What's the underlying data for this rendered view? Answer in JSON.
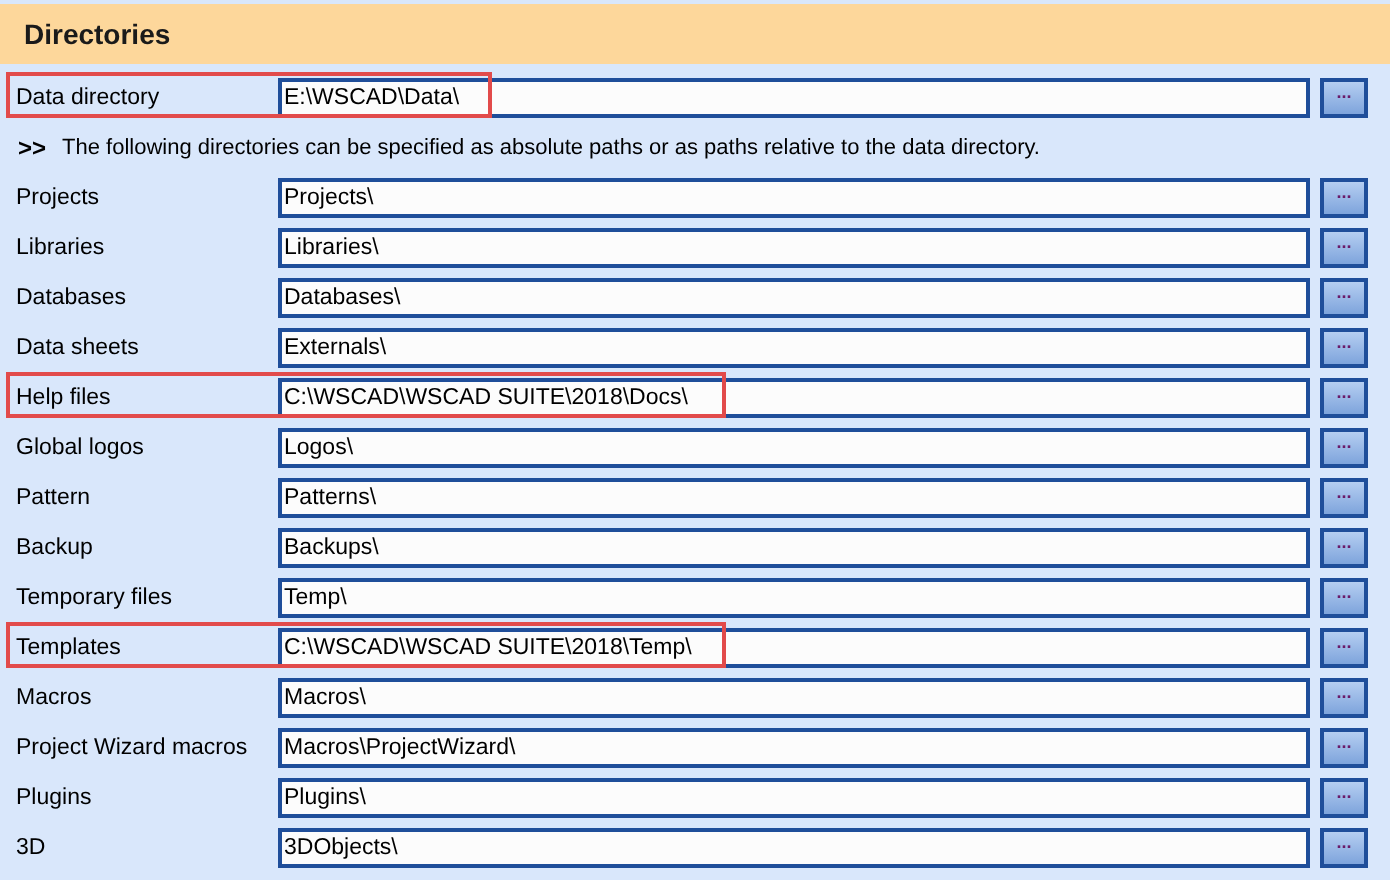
{
  "section": {
    "title": "Directories"
  },
  "rows": [
    {
      "kind": "field",
      "label": "Data directory",
      "value": "E:\\WSCAD\\Data\\",
      "button": "...",
      "highlighted": true
    },
    {
      "kind": "note",
      "marker": ">>",
      "text": "The following directories can be specified as absolute paths or as paths relative to the data directory."
    },
    {
      "kind": "field",
      "label": "Projects",
      "value": "Projects\\",
      "button": "...",
      "highlighted": false
    },
    {
      "kind": "field",
      "label": "Libraries",
      "value": "Libraries\\",
      "button": "...",
      "highlighted": false
    },
    {
      "kind": "field",
      "label": "Databases",
      "value": "Databases\\",
      "button": "...",
      "highlighted": false
    },
    {
      "kind": "field",
      "label": "Data sheets",
      "value": "Externals\\",
      "button": "...",
      "highlighted": false
    },
    {
      "kind": "field",
      "label": "Help files",
      "value": "C:\\WSCAD\\WSCAD SUITE\\2018\\Docs\\",
      "button": "...",
      "highlighted": true
    },
    {
      "kind": "field",
      "label": "Global logos",
      "value": "Logos\\",
      "button": "...",
      "highlighted": false
    },
    {
      "kind": "field",
      "label": "Pattern",
      "value": "Patterns\\",
      "button": "...",
      "highlighted": false
    },
    {
      "kind": "field",
      "label": "Backup",
      "value": "Backups\\",
      "button": "...",
      "highlighted": false
    },
    {
      "kind": "field",
      "label": "Temporary files",
      "value": "Temp\\",
      "button": "...",
      "highlighted": false
    },
    {
      "kind": "field",
      "label": "Templates",
      "value": "C:\\WSCAD\\WSCAD SUITE\\2018\\Temp\\",
      "button": "...",
      "highlighted": true
    },
    {
      "kind": "field",
      "label": "Macros",
      "value": "Macros\\",
      "button": "...",
      "highlighted": false
    },
    {
      "kind": "field",
      "label": "Project Wizard macros",
      "value": "Macros\\ProjectWizard\\",
      "button": "...",
      "highlighted": false
    },
    {
      "kind": "field",
      "label": "Plugins",
      "value": "Plugins\\",
      "button": "...",
      "highlighted": false
    },
    {
      "kind": "field",
      "label": "3D",
      "value": "3DObjects\\",
      "button": "...",
      "highlighted": false
    }
  ]
}
